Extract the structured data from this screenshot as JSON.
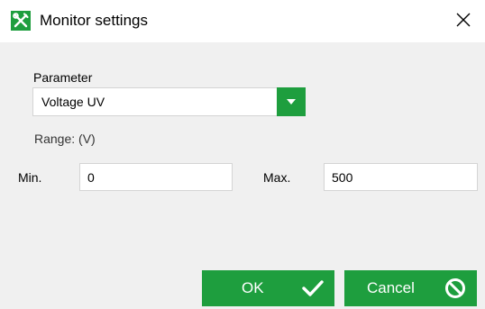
{
  "window": {
    "title": "Monitor settings",
    "app_icon": "tools-icon",
    "close_icon": "close-icon"
  },
  "form": {
    "parameter_label": "Parameter",
    "parameter_value": "Voltage UV",
    "range_label": "Range: (V)",
    "min_label": "Min.",
    "min_value": "0",
    "max_label": "Max.",
    "max_value": "500"
  },
  "buttons": {
    "ok_label": "OK",
    "ok_icon": "checkmark-icon",
    "cancel_label": "Cancel",
    "cancel_icon": "prohibited-icon"
  },
  "colors": {
    "accent": "#1e9e3e",
    "text": "#000000",
    "button_text": "#ffffff"
  }
}
